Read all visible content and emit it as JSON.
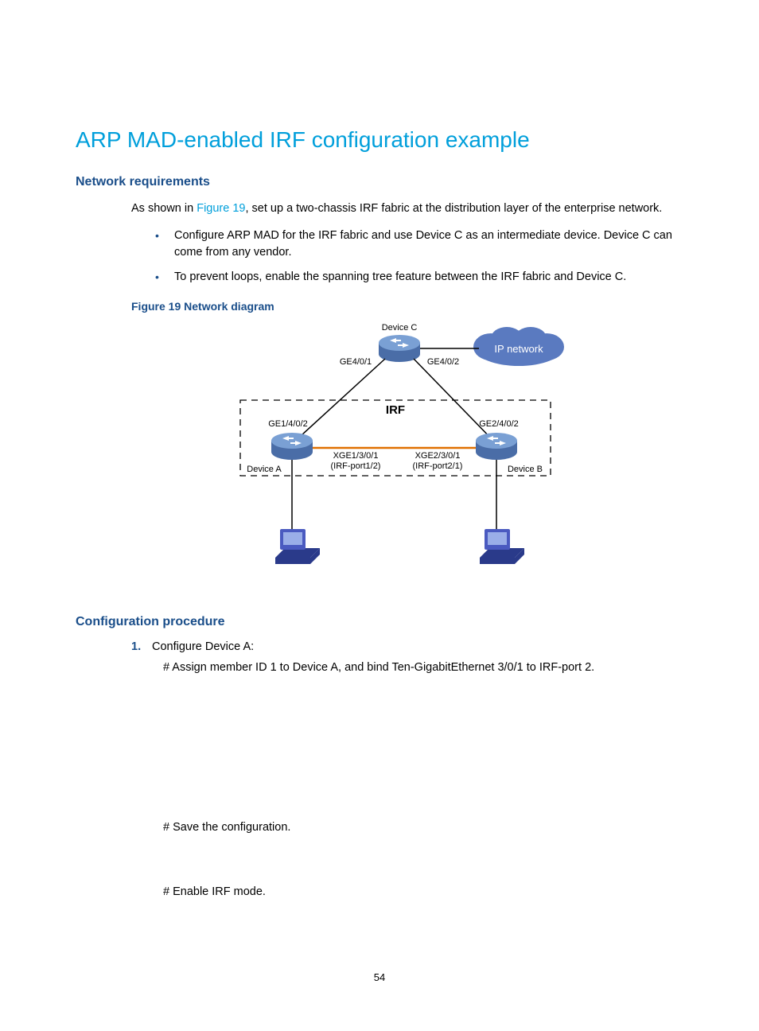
{
  "title": "ARP MAD-enabled IRF configuration example",
  "section_net_req": "Network requirements",
  "intro_prefix": "As shown in ",
  "intro_link": "Figure 19",
  "intro_suffix": ", set up a two-chassis IRF fabric at the distribution layer of the enterprise network.",
  "bullets": [
    "Configure ARP MAD for the IRF fabric and use Device C as an intermediate device. Device C can come from any vendor.",
    "To prevent loops, enable the spanning tree feature between the IRF fabric and Device C."
  ],
  "figure_caption": "Figure 19 Network diagram",
  "diagram": {
    "device_c": "Device C",
    "ge401": "GE4/0/1",
    "ge402": "GE4/0/2",
    "ip_network": "IP network",
    "irf": "IRF",
    "ge1402": "GE1/4/0/2",
    "ge2402": "GE2/4/0/2",
    "xge1301": "XGE1/3/0/1",
    "irf_port12": "(IRF-port1/2)",
    "xge2301": "XGE2/3/0/1",
    "irf_port21": "(IRF-port2/1)",
    "device_a": "Device A",
    "device_b": "Device B"
  },
  "section_config": "Configuration procedure",
  "step1_num": "1.",
  "step1_label": "Configure Device A:",
  "step1_note1": "# Assign member ID 1 to Device A, and bind Ten-GigabitEthernet 3/0/1 to IRF-port 2.",
  "step1_note2": "# Save the configuration.",
  "step1_note3": "# Enable IRF mode.",
  "page_number": "54"
}
